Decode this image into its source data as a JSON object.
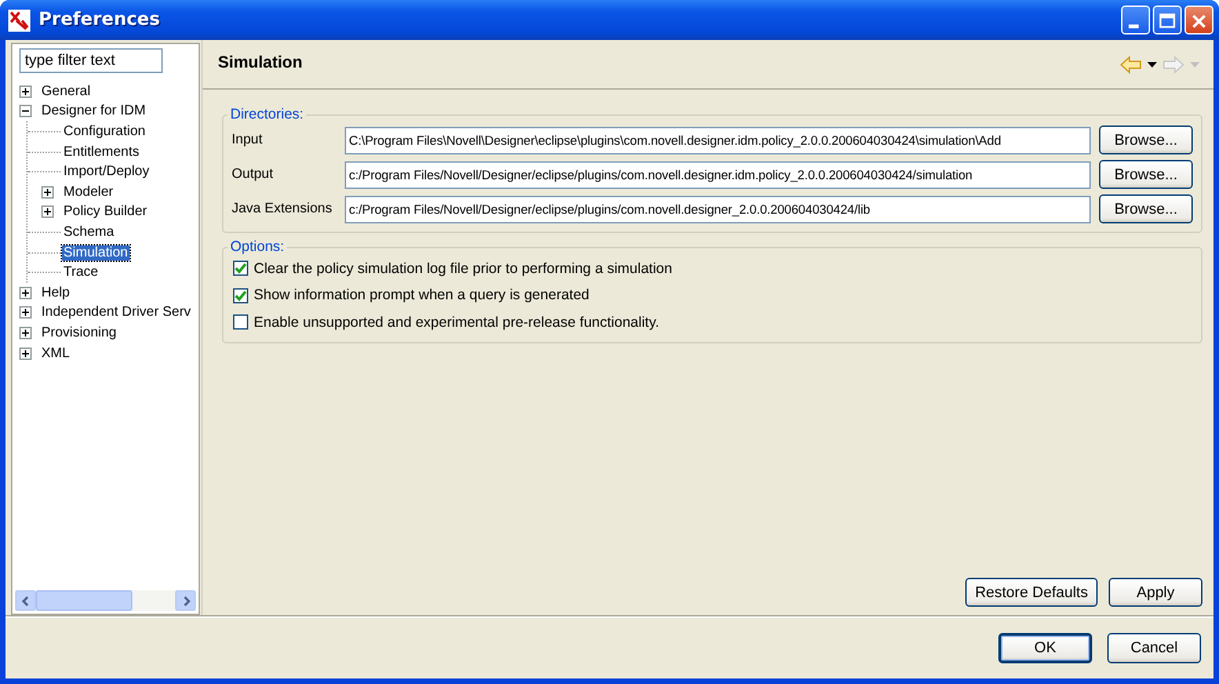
{
  "window": {
    "title": "Preferences"
  },
  "filter": {
    "value": "type filter text"
  },
  "tree": [
    {
      "label": "General",
      "expanded": false,
      "selected": false
    },
    {
      "label": "Designer for IDM",
      "expanded": true,
      "selected": false,
      "children": [
        {
          "label": "Configuration",
          "selected": false
        },
        {
          "label": "Entitlements",
          "selected": false
        },
        {
          "label": "Import/Deploy",
          "selected": false
        },
        {
          "label": "Modeler",
          "expanded": false,
          "selected": false
        },
        {
          "label": "Policy Builder",
          "expanded": false,
          "selected": false
        },
        {
          "label": "Schema",
          "selected": false
        },
        {
          "label": "Simulation",
          "selected": true
        },
        {
          "label": "Trace",
          "selected": false
        }
      ]
    },
    {
      "label": "Help",
      "expanded": false,
      "selected": false
    },
    {
      "label": "Independent Driver Serv",
      "expanded": false,
      "selected": false
    },
    {
      "label": "Provisioning",
      "expanded": false,
      "selected": false
    },
    {
      "label": "XML",
      "expanded": false,
      "selected": false
    }
  ],
  "page": {
    "title": "Simulation"
  },
  "directories": {
    "title": "Directories:",
    "rows": [
      {
        "label": "Input",
        "value": "C:\\Program Files\\Novell\\Designer\\eclipse\\plugins\\com.novell.designer.idm.policy_2.0.0.200604030424\\simulation\\Add",
        "button": "Browse..."
      },
      {
        "label": "Output",
        "value": "c:/Program Files/Novell/Designer/eclipse/plugins/com.novell.designer.idm.policy_2.0.0.200604030424/simulation",
        "button": "Browse..."
      },
      {
        "label": "Java Extensions",
        "value": "c:/Program Files/Novell/Designer/eclipse/plugins/com.novell.designer_2.0.0.200604030424/lib",
        "button": "Browse..."
      }
    ]
  },
  "options": {
    "title": "Options:",
    "items": [
      {
        "label": "Clear the policy simulation log file prior to performing a simulation",
        "checked": true
      },
      {
        "label": "Show information prompt when a query is generated",
        "checked": true
      },
      {
        "label": "Enable unsupported and experimental pre-release functionality.",
        "checked": false
      }
    ]
  },
  "page_buttons": [
    "Restore Defaults",
    "Apply"
  ],
  "dialog_buttons": [
    "OK",
    "Cancel"
  ]
}
